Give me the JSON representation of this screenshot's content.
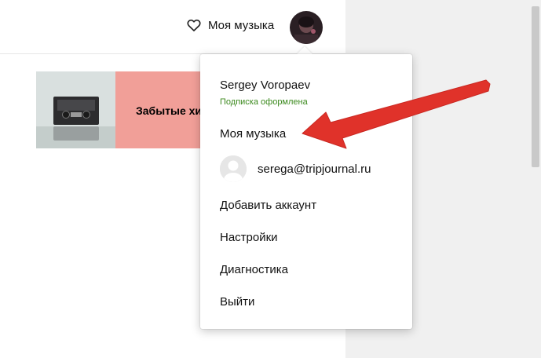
{
  "header": {
    "my_music_label": "Моя музыка"
  },
  "banner": {
    "title": "Забытые хиты"
  },
  "menu": {
    "user_name": "Sergey Voropaev",
    "subscription_status": "Подписка оформлена",
    "items": [
      {
        "label": "Моя музыка"
      },
      {
        "label": "Добавить аккаунт"
      },
      {
        "label": "Настройки"
      },
      {
        "label": "Диагностика"
      },
      {
        "label": "Выйти"
      }
    ],
    "account": {
      "email": "serega@tripjournal.ru"
    }
  },
  "colors": {
    "banner_bg": "#f19f98",
    "subscription_text": "#3c8a1e",
    "annotation_arrow": "#e0322a"
  },
  "icons": [
    "heart-icon",
    "user-avatar",
    "default-avatar-icon",
    "annotation-arrow"
  ]
}
